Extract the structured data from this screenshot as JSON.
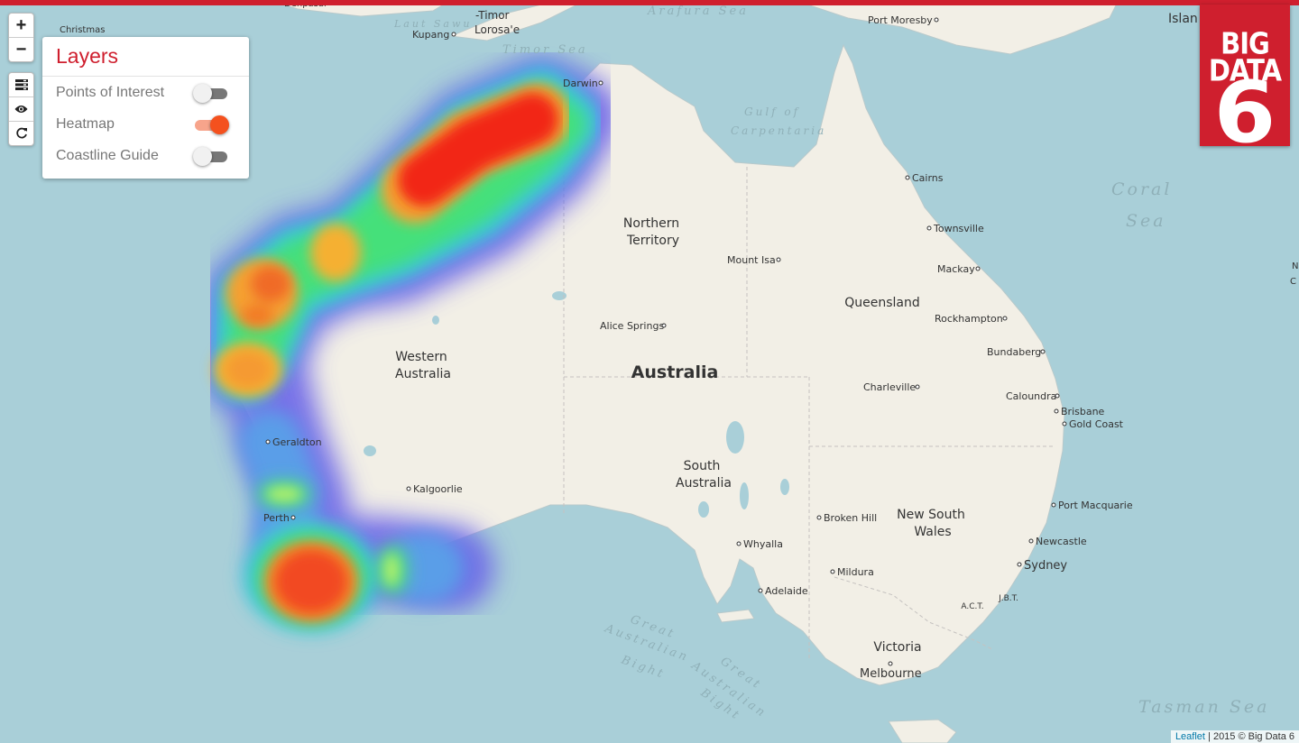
{
  "layers_panel": {
    "title": "Layers",
    "items": [
      {
        "label": "Points of Interest",
        "enabled": false
      },
      {
        "label": "Heatmap",
        "enabled": true
      },
      {
        "label": "Coastline Guide",
        "enabled": false
      }
    ]
  },
  "zoom": {
    "in": "+",
    "out": "−"
  },
  "tools": [
    "layers-icon",
    "eye-icon",
    "refresh-icon"
  ],
  "logo": {
    "line1": "BIG",
    "line2": "DATA",
    "line3": "6"
  },
  "attribution": {
    "link": "Leaflet",
    "text": "| 2015 © Big Data 6"
  },
  "map": {
    "country": "Australia",
    "regions": {
      "wa1": "Western",
      "wa2": "Australia",
      "nt1": "Northern",
      "nt2": "Territory",
      "qld": "Queensland",
      "sa1": "South",
      "sa2": "Australia",
      "nsw1": "New South",
      "nsw2": "Wales",
      "vic": "Victoria",
      "act": "A.C.T.",
      "jbt": "J.B.T."
    },
    "seas": {
      "arafura": "Arafura Sea",
      "timor": "Timor Sea",
      "gulf1": "Gulf of",
      "gulf2": "Carpentaria",
      "coral1": "Coral",
      "coral2": "Sea",
      "tasman": "Tasman Sea",
      "gab1": "Great",
      "gab2": "Australian",
      "gab3": "Bight",
      "gab4": "Great",
      "gab5": "Australian",
      "gab6": "Bight",
      "laut": "Laut Sawu"
    },
    "cities": {
      "darwin": "Darwin",
      "cairns": "Cairns",
      "townsville": "Townsville",
      "mackay": "Mackay",
      "mountisa": "Mount Isa",
      "alice": "Alice Springs",
      "rockhampton": "Rockhampton",
      "bundaberg": "Bundaberg",
      "charleville": "Charleville",
      "caloundra": "Caloundra",
      "brisbane": "Brisbane",
      "goldcoast": "Gold Coast",
      "geraldton": "Geraldton",
      "kalgoorlie": "Kalgoorlie",
      "perth": "Perth",
      "brokenhill": "Broken Hill",
      "whyalla": "Whyalla",
      "portmac": "Port Macquarie",
      "newcastle": "Newcastle",
      "mildura": "Mildura",
      "sydney": "Sydney",
      "adelaide": "Adelaide",
      "melbourne": "Melbourne",
      "portmoresby": "Port Moresby",
      "kupang": "Kupang",
      "timor": "-Timor",
      "lorosae": "Lorosa'e",
      "christmas": "Christmas",
      "denpasar": "Denpasar",
      "island": "Islan",
      "nfrag": "N",
      "cfrag": "C"
    }
  },
  "colors": {
    "accent": "#cf1f2e",
    "switch_on": "#f4511e",
    "land": "#f2efe6",
    "water": "#a9cfd8"
  }
}
